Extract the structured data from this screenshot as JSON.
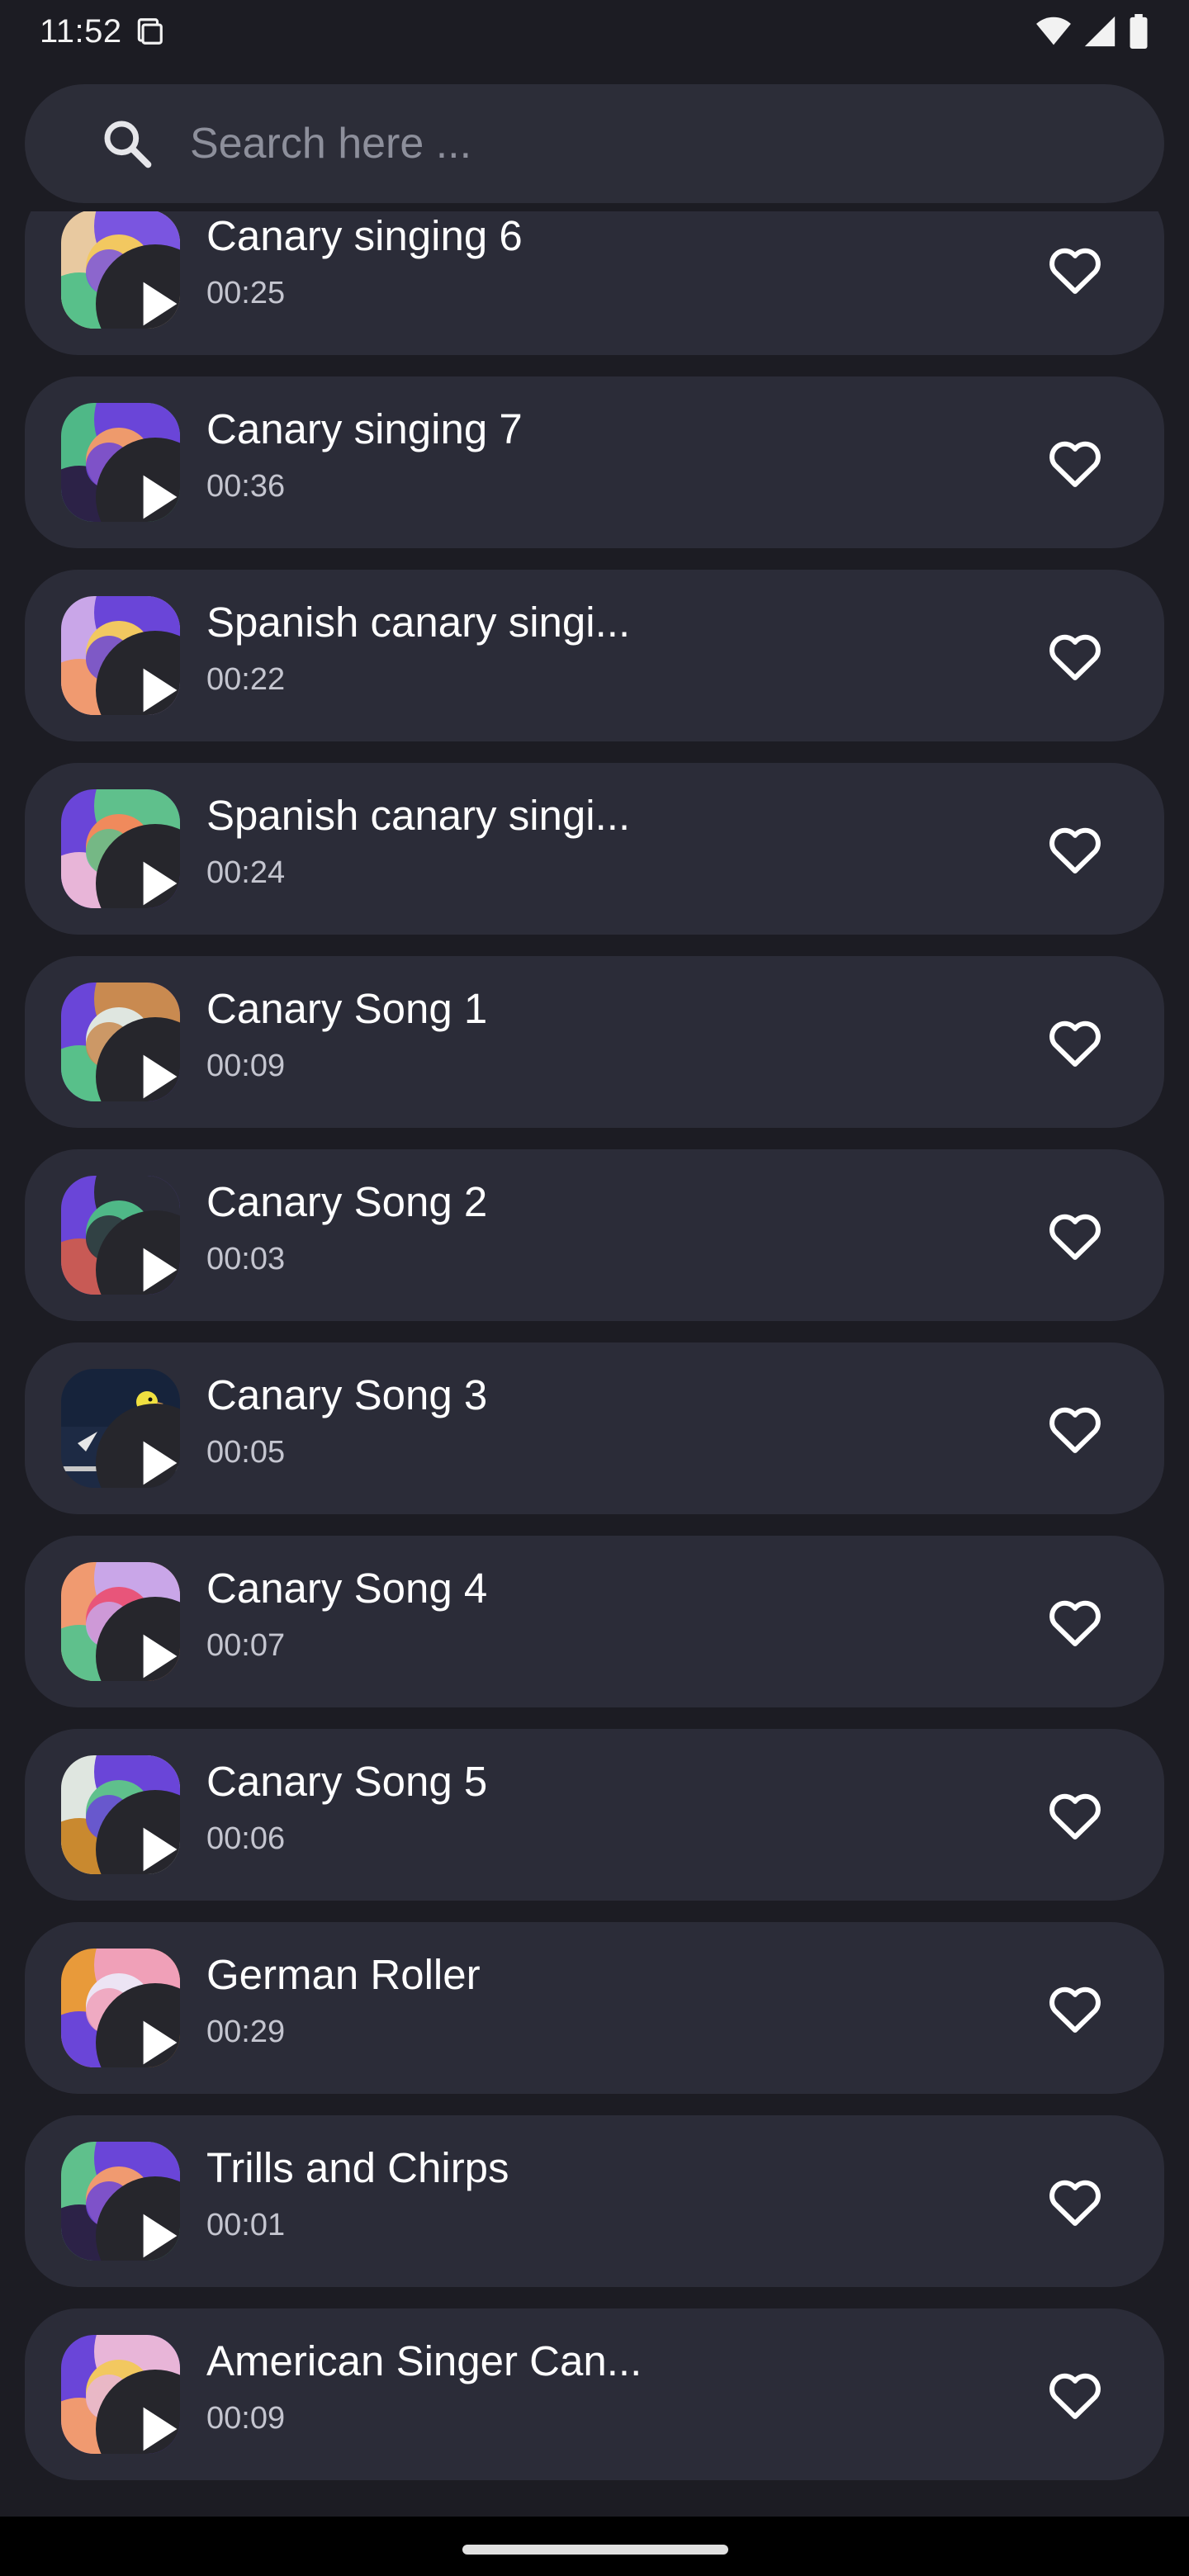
{
  "status_bar": {
    "time": "11:52",
    "icons": [
      "sim-card-icon",
      "wifi-icon",
      "signal-icon",
      "battery-icon"
    ]
  },
  "search": {
    "placeholder": "Search here ...",
    "value": "",
    "icon": "search-icon"
  },
  "tracks": [
    {
      "title": "Canary singing 6",
      "duration": "00:25",
      "thumb": "abstract-art-1"
    },
    {
      "title": "Canary singing 7",
      "duration": "00:36",
      "thumb": "abstract-art-2"
    },
    {
      "title": "Spanish canary singi...",
      "duration": "00:22",
      "thumb": "abstract-art-3"
    },
    {
      "title": "Spanish canary singi...",
      "duration": "00:24",
      "thumb": "abstract-art-4"
    },
    {
      "title": "Canary Song 1",
      "duration": "00:09",
      "thumb": "abstract-art-5"
    },
    {
      "title": "Canary Song 2",
      "duration": "00:03",
      "thumb": "abstract-art-6"
    },
    {
      "title": "Canary Song 3",
      "duration": "00:05",
      "thumb": "canary-photo"
    },
    {
      "title": "Canary Song 4",
      "duration": "00:07",
      "thumb": "abstract-art-7"
    },
    {
      "title": "Canary Song 5",
      "duration": "00:06",
      "thumb": "abstract-art-8"
    },
    {
      "title": "German Roller",
      "duration": "00:29",
      "thumb": "abstract-art-9"
    },
    {
      "title": "Trills and Chirps",
      "duration": "00:01",
      "thumb": "abstract-art-10"
    },
    {
      "title": "American Singer Can...",
      "duration": "00:09",
      "thumb": "abstract-art-11"
    }
  ],
  "colors": {
    "background": "#1c1c23",
    "card": "#2b2c38",
    "search_bar": "#2c2d38",
    "title_text": "#ffffff",
    "duration_text": "#c4c5cf",
    "placeholder_text": "#8d8f9b"
  }
}
